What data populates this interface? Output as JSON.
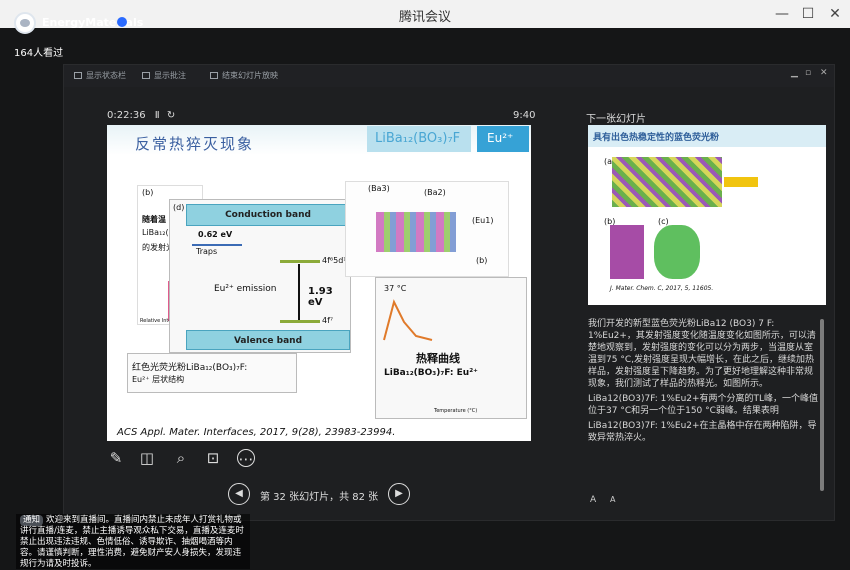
{
  "window": {
    "title": "腾讯会议",
    "buttons": [
      "—",
      "☐",
      "✕"
    ]
  },
  "channel": {
    "name": "EnergyMaterials",
    "viewers": "164人看过"
  },
  "toolbar": {
    "items": [
      "显示状态栏",
      "显示批注",
      "结束幻灯片放映"
    ],
    "right": [
      "▁",
      "▫",
      "✕"
    ]
  },
  "presenter": {
    "timer": "0:22:36",
    "pause": "Ⅱ",
    "refresh": "↻",
    "clock": "9:40"
  },
  "slide": {
    "title": "反常热猝灭现象",
    "formula": "LiBa₁₂(BO₃)₇F",
    "dopant": "Eu²⁺",
    "panel_b": {
      "tag": "(b)",
      "text": "随着温",
      "text2": "LiBa₁₂(BO",
      "text3": "的发射光",
      "ylabel": "Relative Intensity (%)"
    },
    "panel_d": {
      "tag": "(d)",
      "conduction": "Conduction band",
      "valence": "Valence band",
      "traps": "Traps",
      "gap": "0.62 eV",
      "emission": "Eu²⁺ emission",
      "energy": "1.93 eV",
      "upper": "4f⁶5d¹",
      "lower": "4f⁷"
    },
    "panel_c": {
      "t1": "红色光荧光粉LiBa₁₂(BO₃)₇F:",
      "t2": "Eu²⁺ 层状结构"
    },
    "panel_tl": {
      "temp": "37 °C",
      "text": "热释曲线",
      "formula": "LiBa₁₂(BO₃)₇F: Eu²⁺",
      "xlabel": "Temperature (°C)"
    },
    "structure": {
      "ba3": "(Ba3)",
      "ba2": "(Ba2)",
      "eu1": "(Eu1)",
      "b": "(b)",
      "a": "a",
      "bb": "b"
    },
    "citation": "ACS Appl. Mater. Interfaces, 2017, 9(28), 23983-23994."
  },
  "controls": {
    "pen": "✎",
    "grid": "◫",
    "zoom": "⌕",
    "screen": "⊡",
    "more": "⋯"
  },
  "pager": {
    "prev": "◀",
    "text": "第 32 张幻灯片，共 82 张",
    "next": "▶"
  },
  "next_slide": {
    "label": "下一张幻灯片",
    "title": "具有出色热稳定性的蓝色荧光粉",
    "tags": {
      "a": "(a)",
      "b": "(b)",
      "c": "(c)"
    },
    "cite": "J. Mater. Chem. C, 2017, 5, 11605."
  },
  "notes": {
    "p1": "我们开发的新型蓝色荧光粉LiBa12 (BO3) 7 F: 1%Eu2+，其发射强度变化随温度变化如图所示，可以清楚地观察到，发射强度的变化可以分为两步，当温度从室温到75 °C,发射强度呈现大幅增长，在此之后，继续加热样品，发射强度呈下降趋势。为了更好地理解这种非常规现象，我们测试了样品的热释光。如图所示。",
    "p2": "LiBa12(BO3)7F: 1%Eu2+有两个分离的TL峰，一个峰值位于37 °C和另一个位于150 °C弱峰。结果表明",
    "p3": "LiBa12(BO3)7F: 1%Eu2+在主晶格中存在两种陷阱，导致异常热淬火。",
    "font_small": "A",
    "font_large": "A"
  },
  "notice": {
    "tag": "通知",
    "text": "欢迎来到直播间。直播间内禁止未成年人打赏礼物或讲行直播/连麦，禁止主播诱导观众私下交易，直播及连麦时禁止出现违法违规、色情低俗、诱导欺诈、抽烟喝酒等内容。请谨慎判断，理性消费，避免财产安人身损失，发现违规行为请及时投诉。"
  }
}
